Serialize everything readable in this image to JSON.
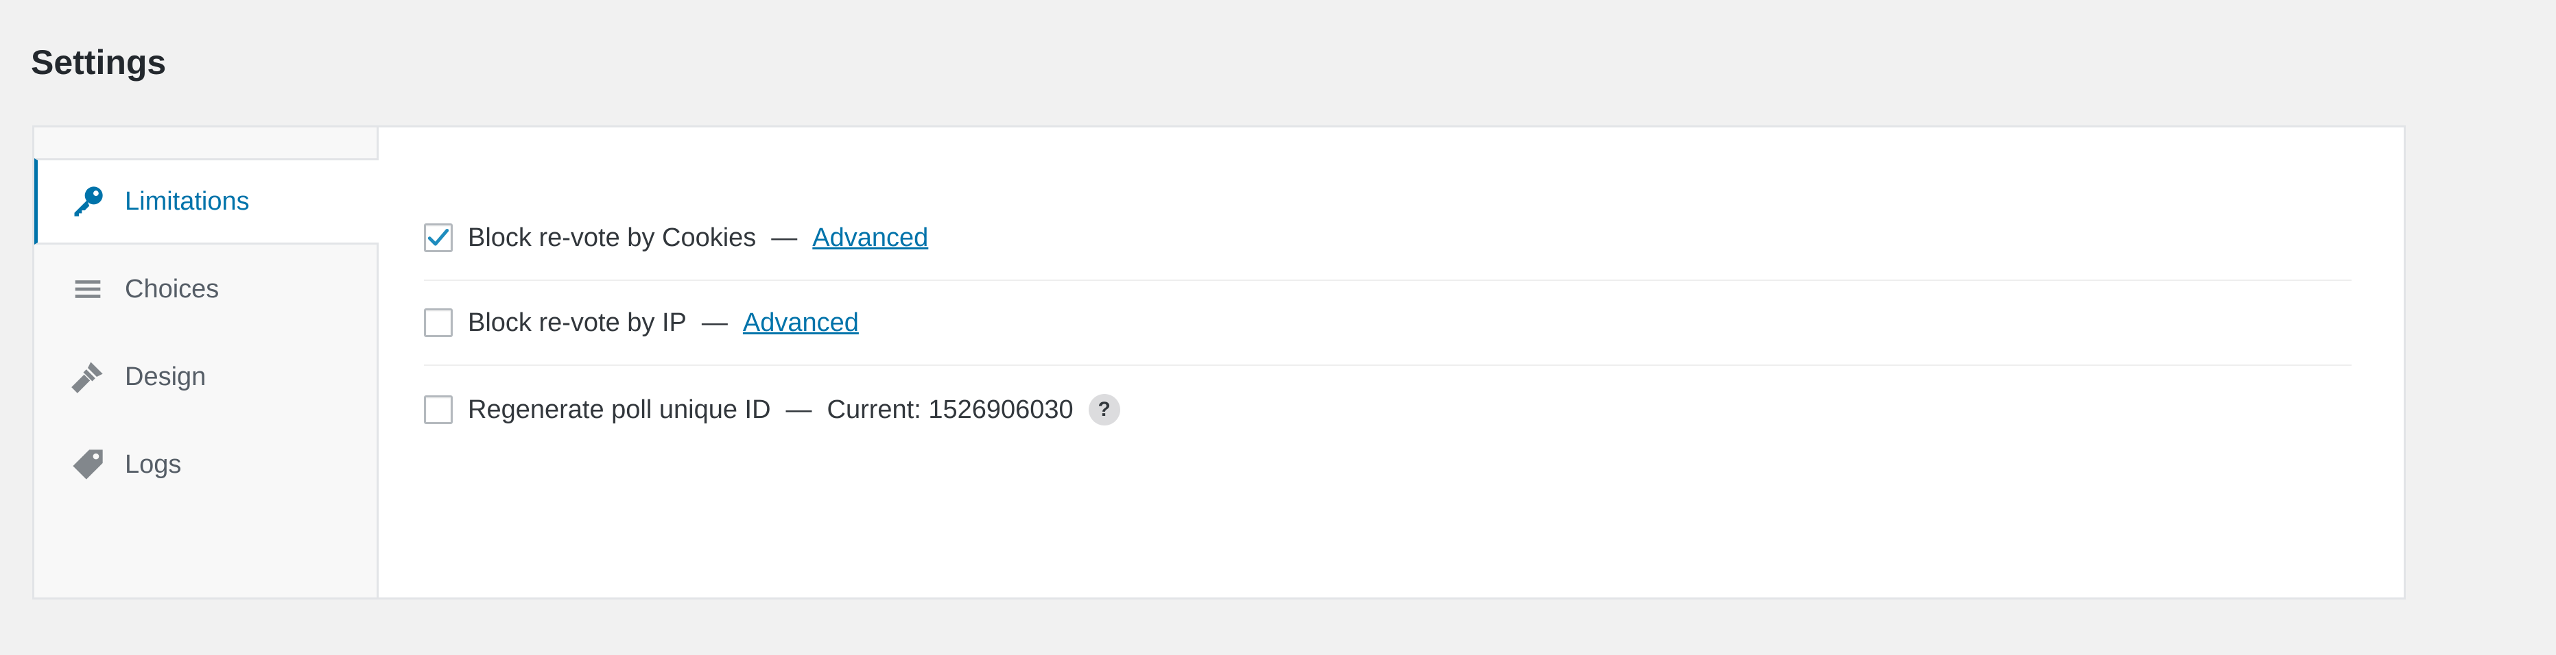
{
  "page": {
    "title": "Settings"
  },
  "sidebar": {
    "items": [
      {
        "label": "Limitations",
        "icon": "key-icon",
        "active": true
      },
      {
        "label": "Choices",
        "icon": "list-icon",
        "active": false
      },
      {
        "label": "Design",
        "icon": "brush-icon",
        "active": false
      },
      {
        "label": "Logs",
        "icon": "tag-icon",
        "active": false
      }
    ]
  },
  "options": [
    {
      "label": "Block re-vote by Cookies",
      "checked": true,
      "separator": "—",
      "link": "Advanced"
    },
    {
      "label": "Block re-vote by IP",
      "checked": false,
      "separator": "—",
      "link": "Advanced"
    },
    {
      "label": "Regenerate poll unique ID",
      "checked": false,
      "separator": "—",
      "info": "Current: 1526906030",
      "help": "?"
    }
  ],
  "colors": {
    "accent": "#0073aa",
    "background": "#f1f1f1",
    "panel": "#ffffff",
    "sidebar": "#f8f8f8",
    "border": "#e2e4e7"
  }
}
